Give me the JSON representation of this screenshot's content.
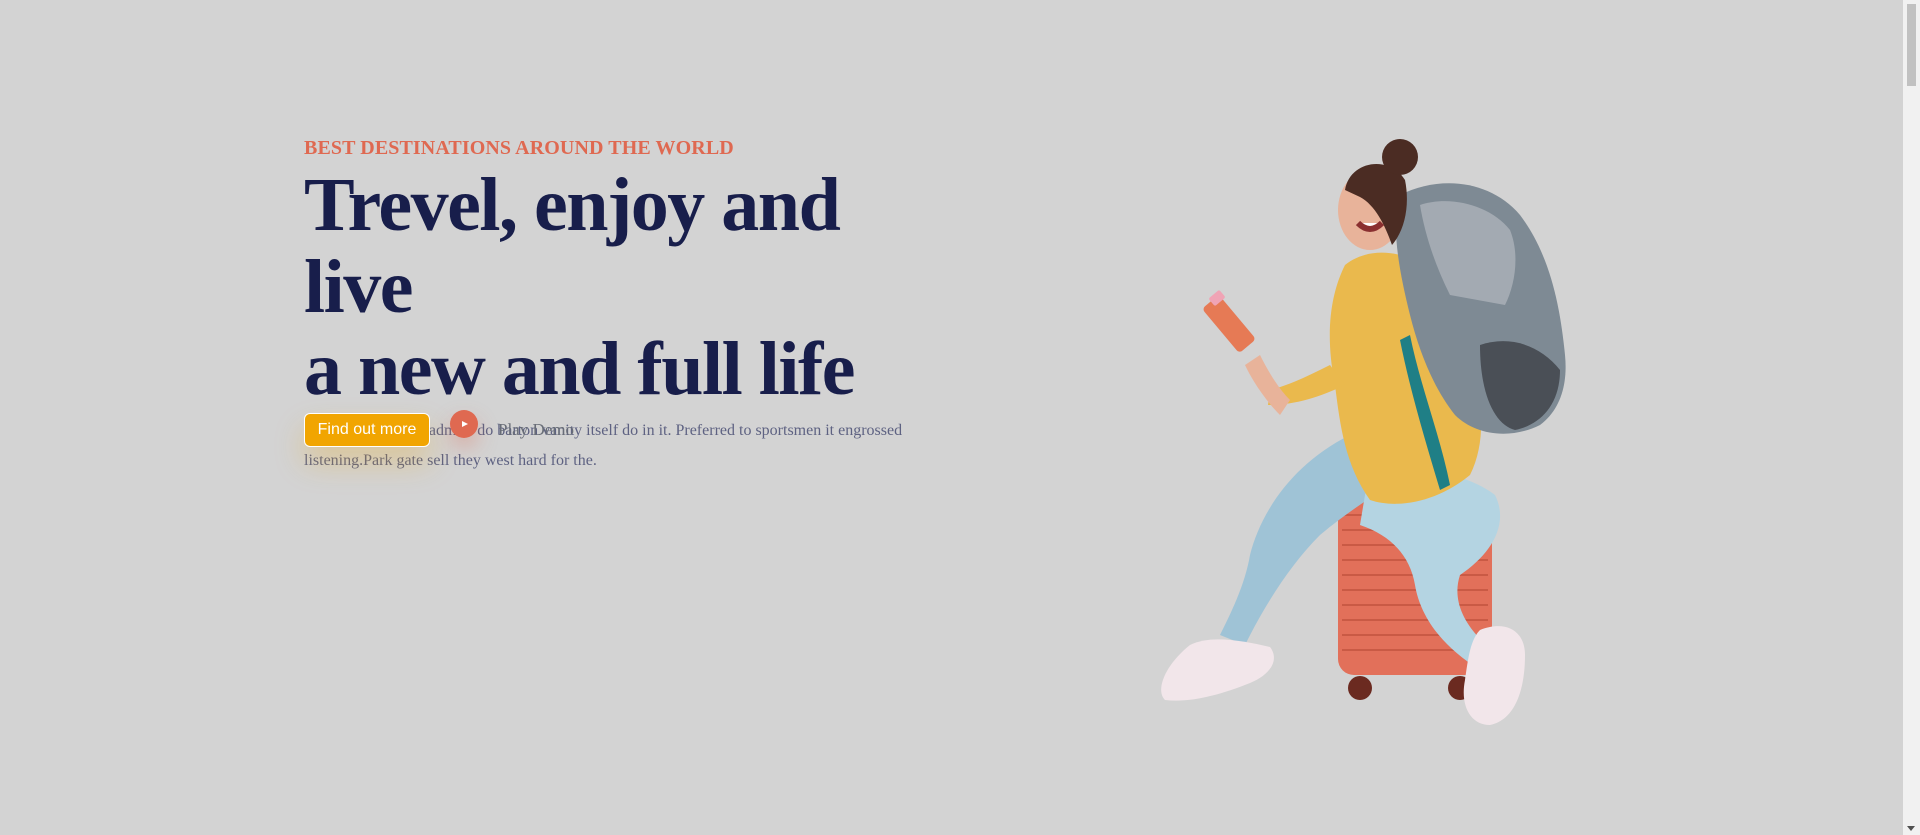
{
  "hero": {
    "eyebrow": "BEST DESTINATIONS AROUND THE WORLD",
    "headline_line1": "Trevel, enjoy and live",
    "headline_line2": "a new and full life",
    "description": "built wicket longer admire do barton vanity itself do in it. Preferred to sportsmen it engrossed listening.Park gate sell they west hard for the.",
    "cta_label": "Find out more",
    "play_label": "Play Demo"
  },
  "colors": {
    "background": "#d3d3d3",
    "accent_orange": "#df6951",
    "accent_yellow": "#f1a501",
    "headline_navy": "#181e4b",
    "body_text": "#5e6282"
  },
  "icons": {
    "play": "play-icon"
  },
  "image": {
    "subject": "traveler-illustration"
  }
}
